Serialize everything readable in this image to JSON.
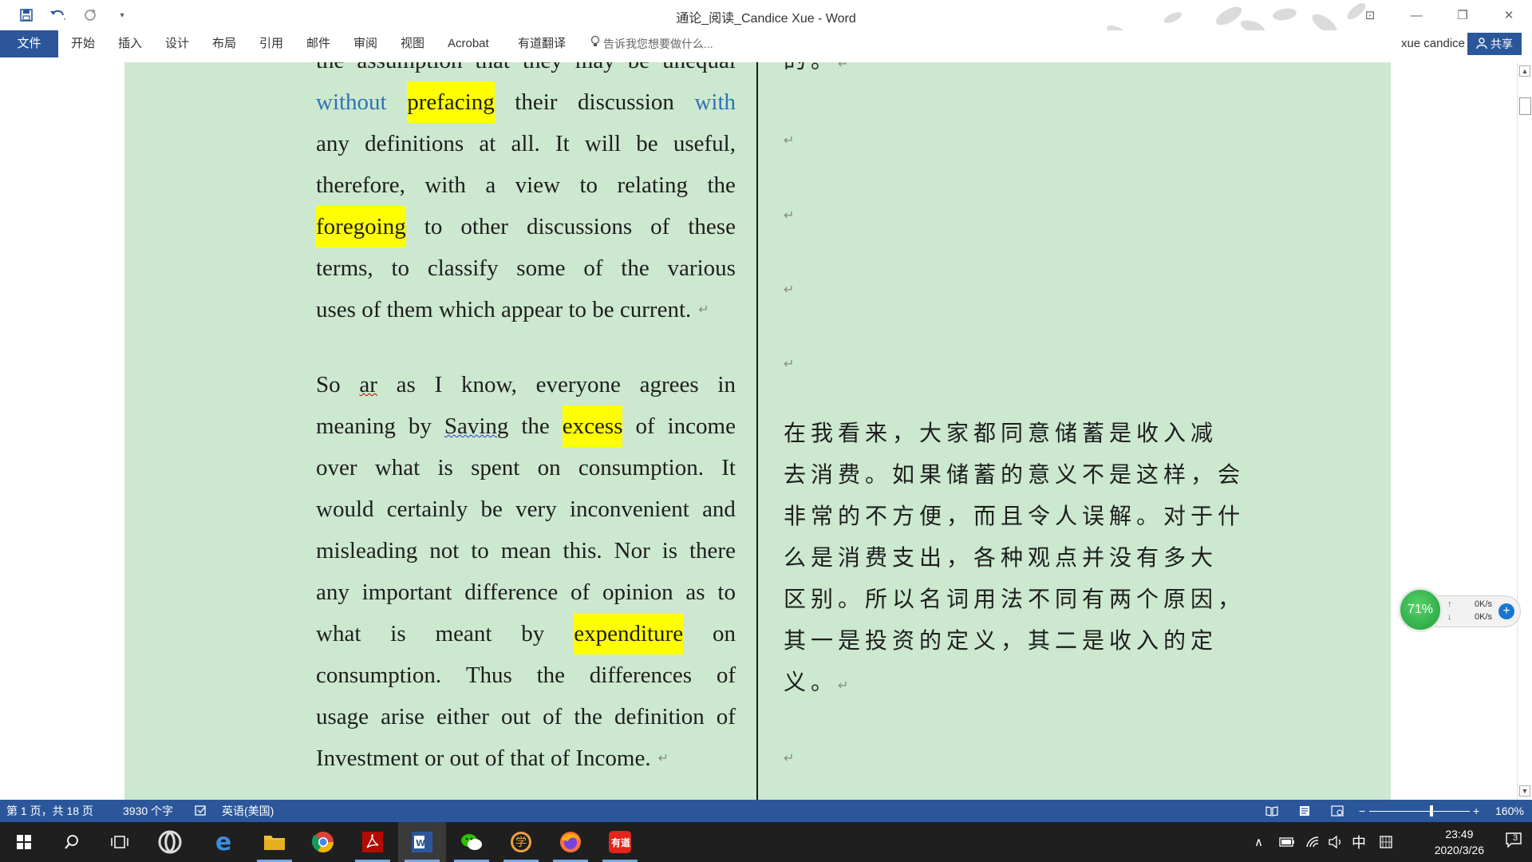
{
  "window": {
    "title": "通论_阅读_Candice Xue - Word",
    "controls": [
      "ribbon-display-options",
      "minimize",
      "restore",
      "close"
    ]
  },
  "quick_access": [
    "save-icon",
    "undo-icon",
    "redo-icon",
    "customize-icon"
  ],
  "ribbon": {
    "file": "文件",
    "tabs": [
      "开始",
      "插入",
      "设计",
      "布局",
      "引用",
      "邮件",
      "审阅",
      "视图",
      "Acrobat",
      "有道翻译"
    ],
    "tellme": "告诉我您想要做什么...",
    "user": "xue candice",
    "share": "共享"
  },
  "document": {
    "english_p1": [
      "the assumption that they may be unequal",
      "without prefacing their discussion with",
      "any definitions at all. It will be useful,",
      "therefore, with a view to relating the",
      "foregoing to other discussions of these",
      "terms, to classify some of the various",
      "uses of them which appear to be current."
    ],
    "english_p2": [
      "So ar as I know, everyone agrees in",
      "meaning by Saving the excess of income",
      "over what is spent on consumption. It",
      "would certainly be very inconvenient and",
      "misleading not to mean this. Nor is there",
      "any important difference of opinion as to",
      "what is meant by expenditure on",
      "consumption. Thus the differences of",
      "usage arise either out of the definition of",
      "Investment or out of that of Income."
    ],
    "highlights": [
      "prefacing",
      "foregoing",
      "excess",
      "expenditure"
    ],
    "chinese_top": "的。",
    "chinese": [
      "在我看来，大家都同意储蓄是收入减",
      "去消费。如果储蓄的意义不是这样，会",
      "非常的不方便，而且令人误解。对于什",
      "么是消费支出，各种观点并没有多大",
      "区别。所以名词用法不同有两个原因，",
      "其一是投资的定义，其二是收入的定",
      "义。"
    ],
    "paragraph_mark": "↵"
  },
  "net_widget": {
    "percent": "71%",
    "up": "0K/s",
    "down": "0K/s"
  },
  "statusbar": {
    "page": "第 1 页，共 18 页",
    "words": "3930 个字",
    "language": "英语(美国)",
    "zoom": "160%"
  },
  "taskbar": {
    "time": "23:49",
    "date": "2020/3/26",
    "ime": "中",
    "notifications": "3"
  },
  "colors": {
    "accent": "#2b579a",
    "page_bg": "#cce8cf",
    "highlight": "#ffff00",
    "blue_text": "#2e74b5"
  }
}
